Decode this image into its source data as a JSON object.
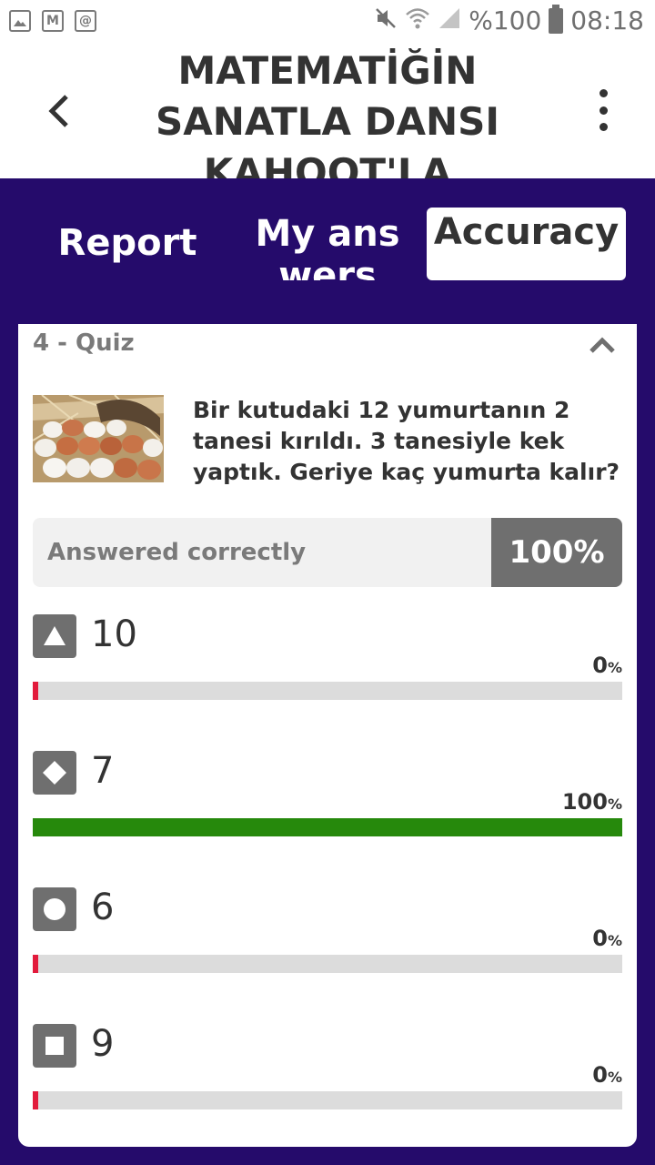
{
  "status_bar": {
    "battery": "%100",
    "time": "08:18",
    "left_icons": [
      "image-icon",
      "gmail-icon",
      "at-icon"
    ],
    "right_icons": [
      "mute-icon",
      "wifi-icon",
      "signal-icon",
      "battery-icon"
    ]
  },
  "header": {
    "title": "MATEMATİĞİN SANATLA DANSI KAHOOT'LA",
    "back_icon": "chevron-left-icon",
    "menu_icon": "more-vertical-icon"
  },
  "tabs": [
    {
      "label": "Report",
      "selected": false
    },
    {
      "label": "My answers",
      "selected": false
    },
    {
      "label": "Accuracy",
      "selected": true
    }
  ],
  "question": {
    "header": "4 - Quiz",
    "text": "Bir kutudaki 12 yumurtanın 2 tanesi kırıldı. 3 tanesiyle kek yaptık. Geriye kaç yumurta kalır?",
    "image": "eggs-photo"
  },
  "summary": {
    "label": "Answered correctly",
    "value": "100%"
  },
  "answers": [
    {
      "shape": "triangle-icon",
      "text": "10",
      "pct": "0",
      "unit": "%",
      "fill": 0,
      "color": "#e21b3c"
    },
    {
      "shape": "diamond-icon",
      "text": "7",
      "pct": "100",
      "unit": "%",
      "fill": 1,
      "color": "#26890c"
    },
    {
      "shape": "circle-icon",
      "text": "6",
      "pct": "0",
      "unit": "%",
      "fill": 0,
      "color": "#e21b3c"
    },
    {
      "shape": "square-icon",
      "text": "9",
      "pct": "0",
      "unit": "%",
      "fill": 0,
      "color": "#e21b3c"
    }
  ],
  "colors": {
    "brand_purple": "#250b6b",
    "correct_green": "#26890c",
    "wrong_red": "#e21b3c"
  }
}
